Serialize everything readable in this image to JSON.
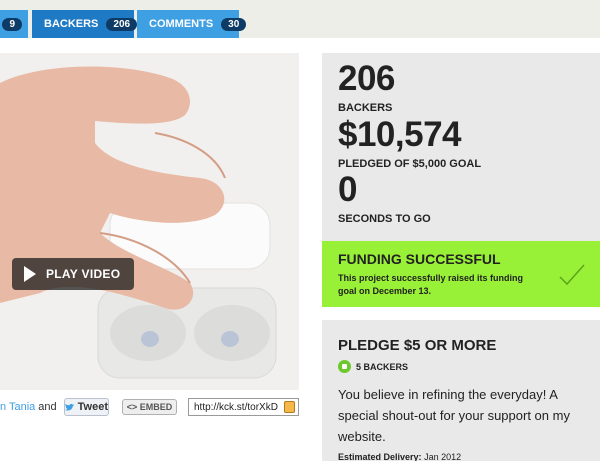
{
  "tabs": [
    {
      "label": "",
      "count": "9"
    },
    {
      "label": "BACKERS",
      "count": "206"
    },
    {
      "label": "COMMENTS",
      "count": "30"
    }
  ],
  "video": {
    "play_label": "PLAY VIDEO"
  },
  "share": {
    "creator_link": "n Tania",
    "and_text": "and",
    "tweet_label": "Tweet",
    "embed_label": "<> EMBED",
    "short_url": "http://kck.st/torXkD"
  },
  "stats": {
    "backers_count": "206",
    "backers_label": "BACKERS",
    "pledged_amount": "$10,574",
    "pledged_label": "PLEDGED OF $5,000 GOAL",
    "seconds_value": "0",
    "seconds_label": "SECONDS TO GO"
  },
  "funding": {
    "title": "FUNDING SUCCESSFUL",
    "description": "This project successfully raised its funding goal on December 13.",
    "accent_color": "#98f037"
  },
  "reward": {
    "title": "PLEDGE $5 OR MORE",
    "backers": "5 BACKERS",
    "description": "You believe in refining the everyday! A special shout-out for your support on my website.",
    "delivery_label": "Estimated Delivery:",
    "delivery_value": "Jan 2012"
  },
  "colors": {
    "tab_blue": "#3e9fe3",
    "tab_active": "#1f7ac6",
    "panel_gray": "#e9e9e9"
  }
}
